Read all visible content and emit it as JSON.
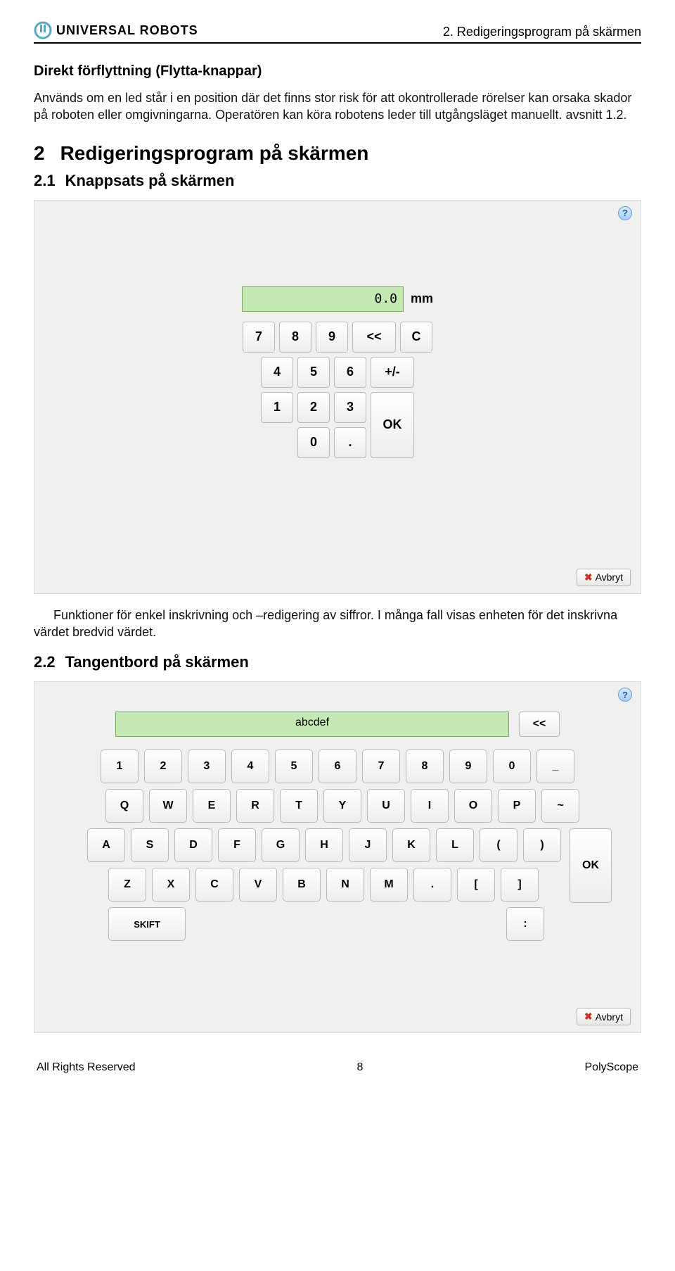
{
  "header": {
    "brand": "UNIVERSAL ROBOTS",
    "right": "2. Redigeringsprogram på skärmen"
  },
  "section_move": {
    "title": "Direkt förflyttning (Flytta-knappar)",
    "body": "Används om en led står i en position där det finns stor risk för att okontrollerade rörelser kan orsaka skador på roboten eller omgivningarna. Operatören kan köra robotens leder till utgångsläget manuellt. avsnitt 1.2."
  },
  "h2": {
    "num": "2",
    "text": "Redigeringsprogram på skärmen"
  },
  "h3a": {
    "num": "2.1",
    "text": "Knappsats på skärmen"
  },
  "numpad": {
    "display": "0.0",
    "unit": "mm",
    "keys": {
      "k7": "7",
      "k8": "8",
      "k9": "9",
      "back": "<<",
      "c": "C",
      "k4": "4",
      "k5": "5",
      "k6": "6",
      "pm": "+/-",
      "k1": "1",
      "k2": "2",
      "k3": "3",
      "ok": "OK",
      "k0": "0",
      "dot": "."
    },
    "avbryt": "Avbryt",
    "help": "?"
  },
  "para_after_numpad": "Funktioner för enkel inskrivning och –redigering av siffror. I många fall visas enheten för det inskrivna värdet bredvid värdet.",
  "h3b": {
    "num": "2.2",
    "text": "Tangentbord på skärmen"
  },
  "keyboard": {
    "input": "abcdef",
    "back": "<<",
    "row_num": [
      "1",
      "2",
      "3",
      "4",
      "5",
      "6",
      "7",
      "8",
      "9",
      "0",
      "_"
    ],
    "row_q": [
      "Q",
      "W",
      "E",
      "R",
      "T",
      "Y",
      "U",
      "I",
      "O",
      "P",
      "~"
    ],
    "row_a": [
      "A",
      "S",
      "D",
      "F",
      "G",
      "H",
      "J",
      "K",
      "L",
      "(",
      ")"
    ],
    "row_z": [
      "Z",
      "X",
      "C",
      "V",
      "B",
      "N",
      "M",
      ".",
      "[",
      "]"
    ],
    "ok": "OK",
    "shift": "SKIFT",
    "colon": ":",
    "avbryt": "Avbryt",
    "help": "?"
  },
  "footer": {
    "left": "All Rights Reserved",
    "page": "8",
    "right": "PolyScope"
  }
}
